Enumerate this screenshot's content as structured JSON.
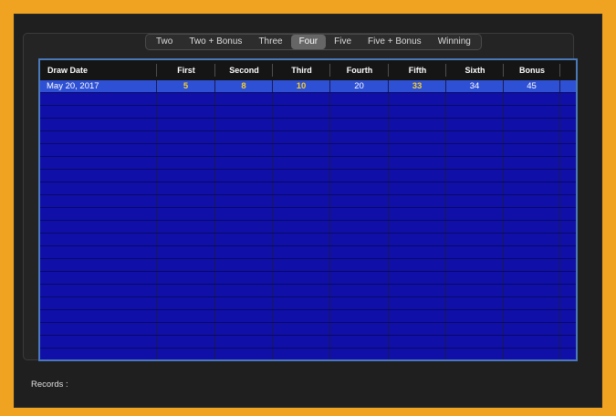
{
  "tabs": [
    {
      "label": "Two",
      "selected": false
    },
    {
      "label": "Two + Bonus",
      "selected": false
    },
    {
      "label": "Three",
      "selected": false
    },
    {
      "label": "Four",
      "selected": true
    },
    {
      "label": "Five",
      "selected": false
    },
    {
      "label": "Five + Bonus",
      "selected": false
    },
    {
      "label": "Winning",
      "selected": false
    }
  ],
  "table": {
    "columns": [
      "Draw Date",
      "First",
      "Second",
      "Third",
      "Fourth",
      "Fifth",
      "Sixth",
      "Bonus"
    ],
    "rows": [
      {
        "selected": true,
        "cells": [
          "May 20, 2017",
          "5",
          "8",
          "10",
          "20",
          "33",
          "34",
          "45"
        ],
        "highlight": [
          false,
          true,
          true,
          true,
          false,
          true,
          false,
          false
        ]
      }
    ],
    "empty_row_count": 21
  },
  "footer": {
    "records_label": "Records :"
  },
  "colors": {
    "frame": "#f0a321",
    "table_bg": "#1010a8",
    "selected_row": "#2e50d4",
    "highlight_number": "#f6cf2e"
  }
}
